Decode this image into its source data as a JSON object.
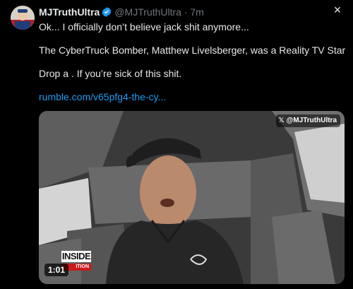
{
  "author": {
    "name": "MJTruthUltra",
    "handle": "@MJTruthUltra",
    "separator": "·",
    "time": "7m"
  },
  "close_icon": "×",
  "post": {
    "line1": "Ok... I officially don’t believe jack shit anymore...",
    "line2": "The CyberTruck Bomber, Matthew Livelsberger, was a Reality TV Star",
    "line3": "Drop a . If you’re sick of this shit.",
    "link": "rumble.com/v65pfg4-the-cy..."
  },
  "video": {
    "watermark_logo": "𝕏",
    "watermark_handle": "@MJTruthUltra",
    "overlay_logo_top": "INSIDE",
    "overlay_logo_bottom": "ITION",
    "duration": "1:01"
  },
  "colors": {
    "background": "#000000",
    "text": "#e7e9ea",
    "secondary": "#71767b",
    "link": "#1d9bf0",
    "verified": "#1d9bf0"
  },
  "icons": [
    "avatar",
    "verified-badge-icon",
    "close-icon",
    "x-logo-icon"
  ]
}
